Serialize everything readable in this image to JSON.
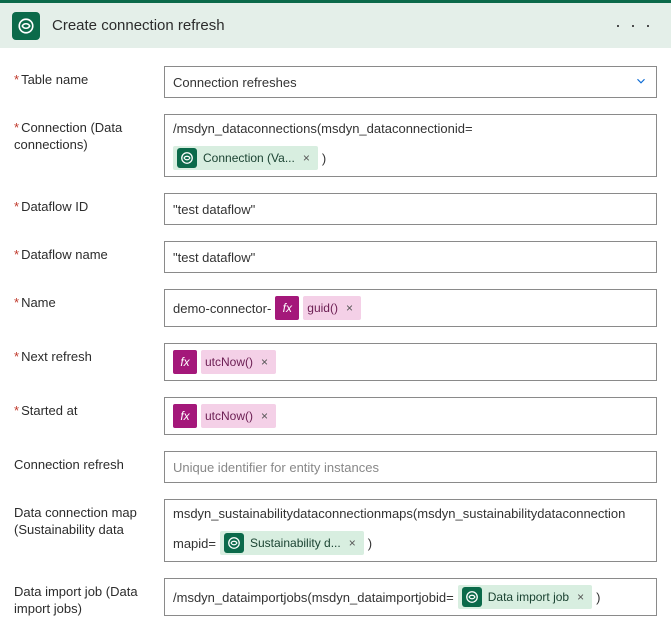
{
  "header": {
    "title": "Create connection refresh",
    "more": "· · ·"
  },
  "labels": {
    "table_name": "Table name",
    "connection": "Connection (Data connections)",
    "dataflow_id": "Dataflow ID",
    "dataflow_name": "Dataflow name",
    "name": "Name",
    "next_refresh": "Next refresh",
    "started_at": "Started at",
    "connection_refresh": "Connection refresh",
    "data_connection_map": "Data connection map (Sustainability data",
    "data_import_job": "Data import job (Data import jobs)"
  },
  "fields": {
    "table_name": "Connection refreshes",
    "connection_prefix": "/msdyn_dataconnections(msdyn_dataconnectionid=",
    "connection_token": "Connection (Va...",
    "connection_suffix": ")",
    "dataflow_id": "\"test dataflow\"",
    "dataflow_name": "\"test dataflow\"",
    "name_prefix": "demo-connector-",
    "name_token": "guid()",
    "next_refresh_token": "utcNow()",
    "started_at_token": "utcNow()",
    "connection_refresh_placeholder": "Unique identifier for entity instances",
    "data_map_line1": "msdyn_sustainabilitydataconnectionmaps(msdyn_sustainabilitydataconnection",
    "data_map_line2_prefix": "mapid=",
    "data_map_token": "Sustainability d...",
    "data_map_suffix": ")",
    "data_import_prefix": "/msdyn_dataimportjobs(msdyn_dataimportjobid=",
    "data_import_token": "Data import job",
    "data_import_suffix": ")"
  },
  "glyphs": {
    "remove": "×",
    "fx": "fx"
  }
}
